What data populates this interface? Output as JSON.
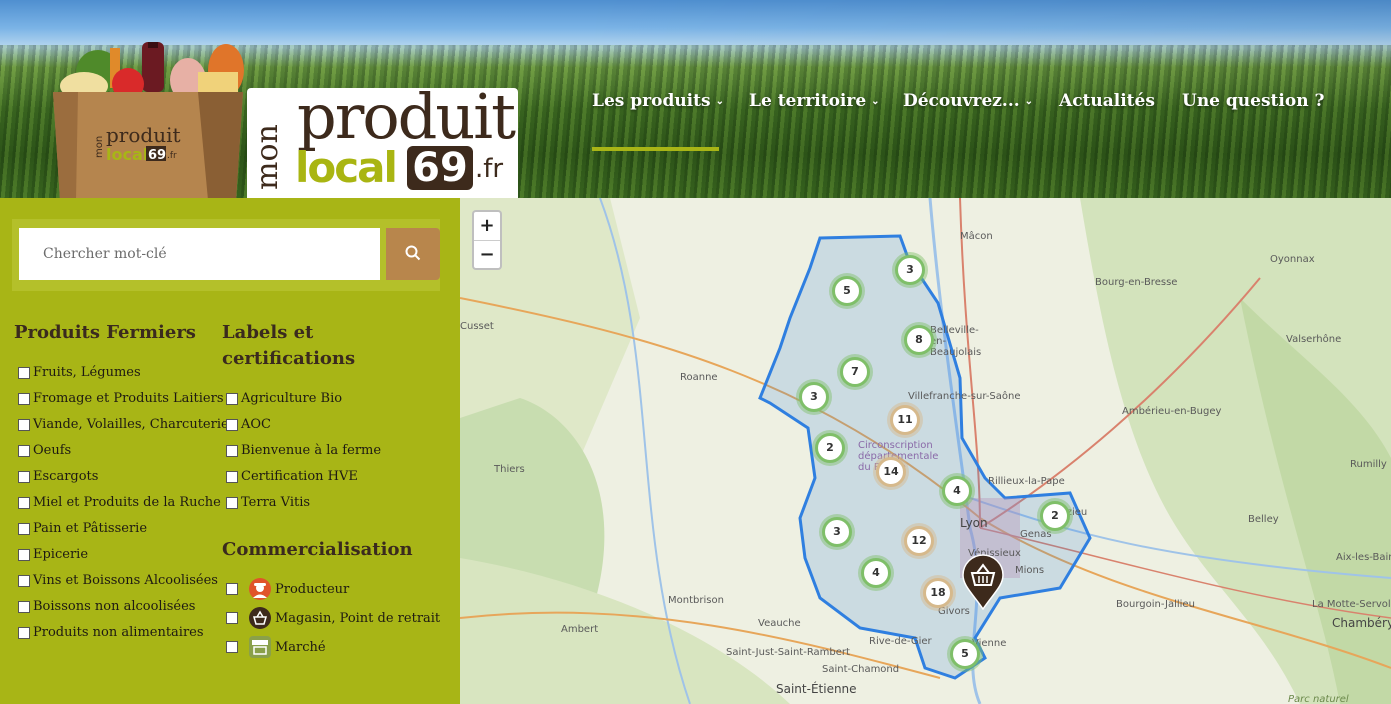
{
  "logo": {
    "mon": "mon",
    "produit": "produit",
    "local": "local",
    "number": "69",
    "tld": ".fr",
    "bag_produit": "produit",
    "bag_local": "local",
    "bag_number": "69",
    "bag_tld": ".fr",
    "bag_mon": "mon"
  },
  "nav": {
    "items": [
      {
        "label": "Les produits",
        "chevron": "⌄",
        "active": true
      },
      {
        "label": "Le territoire",
        "chevron": "⌄"
      },
      {
        "label": "Découvrez...",
        "chevron": "⌄"
      },
      {
        "label": "Actualités"
      },
      {
        "label": "Une question ?"
      }
    ]
  },
  "search": {
    "placeholder": "Chercher mot-clé",
    "icon": "search-icon"
  },
  "filters": {
    "produits_title": "Produits Fermiers",
    "produits": [
      "Fruits, Légumes",
      "Fromage et Produits Laitiers",
      "Viande, Volailles, Charcuterie",
      "Oeufs",
      "Escargots",
      "Miel et Produits de la Ruche",
      "Pain et Pâtisserie",
      "Epicerie",
      "Vins et Boissons Alcoolisées",
      "Boissons non alcoolisées",
      "Produits non alimentaires"
    ],
    "labels_title_line1": "Labels et",
    "labels_title_line2": "certifications",
    "labels": [
      "Agriculture Bio",
      "AOC",
      "Bienvenue à la ferme",
      "Certification HVE",
      "Terra Vitis"
    ],
    "comm_title": "Commercialisation",
    "commercialisation": [
      {
        "label": "Producteur",
        "icon": "farmer-icon",
        "color": "#e0542a"
      },
      {
        "label": "Magasin, Point de retrait",
        "icon": "basket-icon",
        "color": "#3d2a1c"
      },
      {
        "label": "Marché",
        "icon": "market-stall-icon",
        "color": "#8aa04a"
      }
    ]
  },
  "map": {
    "zoom_in": "+",
    "zoom_out": "−",
    "cities": [
      "Mâcon",
      "Bourg-en-Bresse",
      "Oyonnax",
      "Cusset",
      "Roanne",
      "Villefranche-sur-Saône",
      "Valserhône",
      "Ambérieu-en-Bugey",
      "Thiers",
      "Rillieux-la-Pape",
      "Lyon",
      "Meyzieu",
      "Genas",
      "Vénissieux",
      "Mions",
      "Belley",
      "Aix-les-Bains",
      "Rumilly",
      "Bourgoin-Jallieu",
      "La Motte-Servolex",
      "Chambéry",
      "Montbrison",
      "Ambert",
      "Veauche",
      "Saint-Just-Saint-Rambert",
      "Saint-Chamond",
      "Rive-de-Gier",
      "Saint-Étienne",
      "Givors",
      "Vienne",
      "Circonscription départementale du Rhône",
      "Parc naturel",
      "Belleville-en-Beaujolais"
    ],
    "clusters": [
      {
        "count": "3",
        "type": "green"
      },
      {
        "count": "5",
        "type": "green"
      },
      {
        "count": "8",
        "type": "green"
      },
      {
        "count": "7",
        "type": "green"
      },
      {
        "count": "3",
        "type": "green"
      },
      {
        "count": "11",
        "type": "tan"
      },
      {
        "count": "2",
        "type": "green"
      },
      {
        "count": "14",
        "type": "tan"
      },
      {
        "count": "4",
        "type": "green"
      },
      {
        "count": "2",
        "type": "green"
      },
      {
        "count": "3",
        "type": "green"
      },
      {
        "count": "12",
        "type": "tan"
      },
      {
        "count": "4",
        "type": "green"
      },
      {
        "count": "18",
        "type": "tan"
      },
      {
        "count": "5",
        "type": "green"
      }
    ],
    "marker_icon": "basket-icon",
    "region_color": "#2f7fe0"
  },
  "colors": {
    "sidebar": "#a8b516",
    "accent_brown": "#3d2a1c",
    "search_button": "#b8864c"
  }
}
